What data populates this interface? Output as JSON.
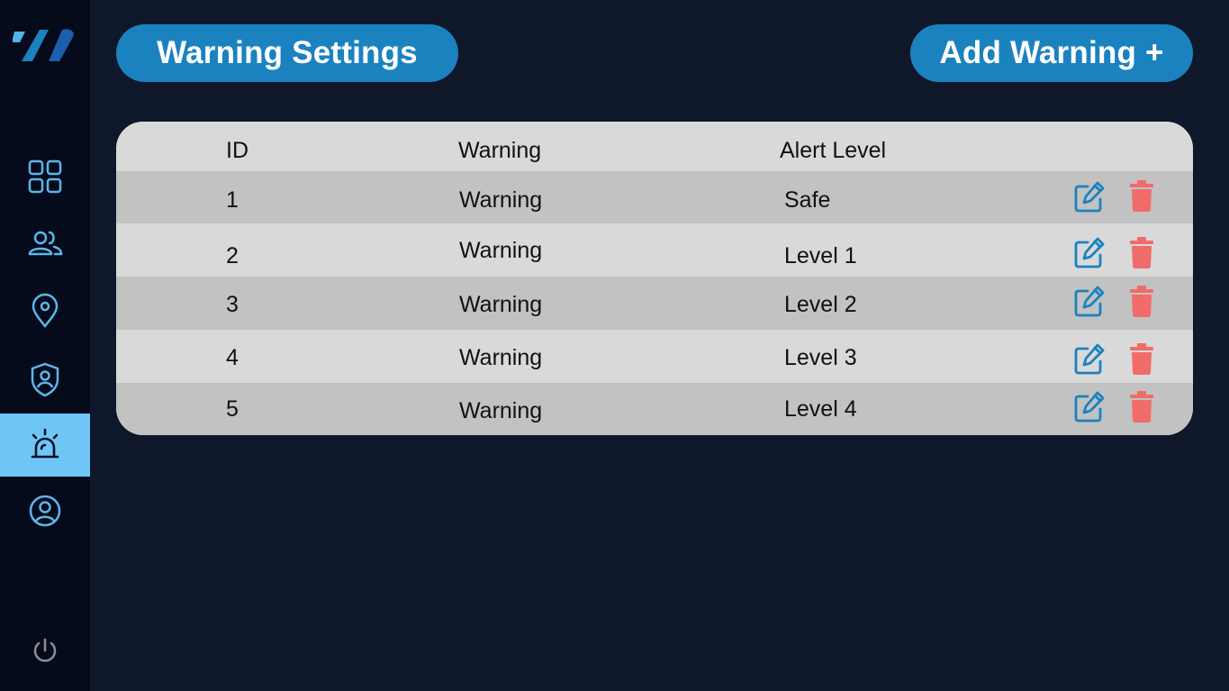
{
  "colors": {
    "background": "#0f172a",
    "sidebar": "#050b1a",
    "accent": "#1b82c0",
    "active_nav": "#6ec6f7",
    "delete": "#f26b6b"
  },
  "sidebar": {
    "logo_icon": "brand-slash-logo",
    "items": [
      {
        "icon": "dashboard-grid-icon",
        "active": false
      },
      {
        "icon": "users-icon",
        "active": false
      },
      {
        "icon": "location-pin-icon",
        "active": false
      },
      {
        "icon": "shield-user-icon",
        "active": false
      },
      {
        "icon": "alarm-siren-icon",
        "active": true
      },
      {
        "icon": "user-circle-icon",
        "active": false
      }
    ],
    "power_icon": "power-icon"
  },
  "header": {
    "title": "Warning Settings",
    "add_button": "Add Warning +"
  },
  "table": {
    "columns": [
      "ID",
      "Warning",
      "Alert Level"
    ],
    "rows": [
      {
        "id": "1",
        "warning": "Warning",
        "level": "Safe"
      },
      {
        "id": "2",
        "warning": "Warning",
        "level": "Level 1"
      },
      {
        "id": "3",
        "warning": "Warning",
        "level": "Level 2"
      },
      {
        "id": "4",
        "warning": "Warning",
        "level": "Level 3"
      },
      {
        "id": "5",
        "warning": "Warning",
        "level": "Level 4"
      }
    ],
    "row_icons": [
      "edit-icon",
      "trash-icon"
    ]
  }
}
